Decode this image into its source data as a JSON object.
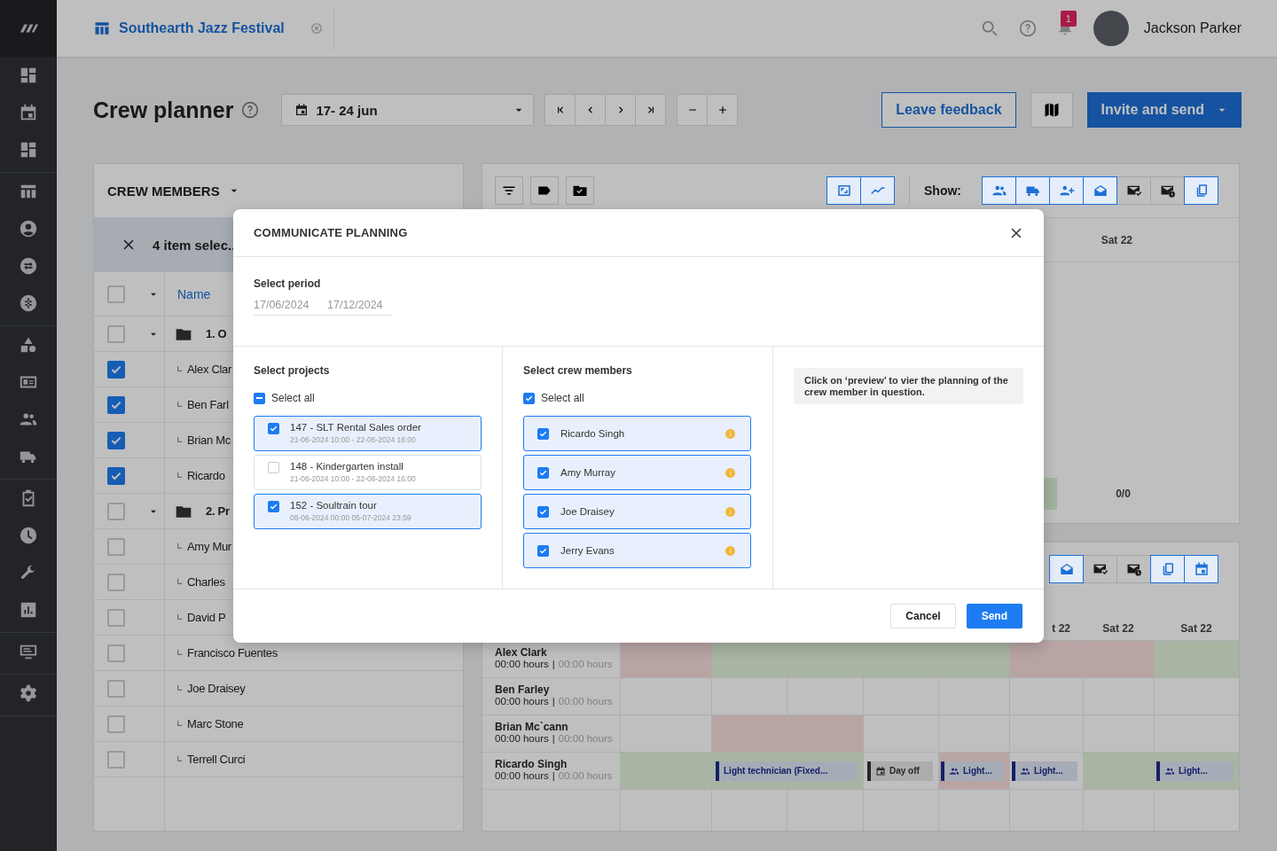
{
  "topbar": {
    "project": "Southearth Jazz Festival",
    "notifications": "1",
    "user": "Jackson Parker"
  },
  "header": {
    "title": "Crew planner",
    "date_range": "17- 24 jun",
    "feedback": "Leave feedback",
    "invite": "Invite and send"
  },
  "crew_panel": {
    "title": "CREW MEMBERS",
    "selection": "4 item selec..",
    "column": {
      "label": "Name",
      "checked": false
    },
    "rows": [
      {
        "kind": "group",
        "label": "1. O",
        "checked": false,
        "expanded": true
      },
      {
        "kind": "member",
        "label": "Alex Clar",
        "checked": true
      },
      {
        "kind": "member",
        "label": "Ben Farl",
        "checked": true
      },
      {
        "kind": "member",
        "label": "Brian Mc",
        "checked": true
      },
      {
        "kind": "member",
        "label": "Ricardo",
        "checked": true
      },
      {
        "kind": "group",
        "label": "2. Pr",
        "checked": false,
        "expanded": true
      },
      {
        "kind": "member",
        "label": "Amy Mur",
        "checked": false
      },
      {
        "kind": "member",
        "label": "Charles",
        "checked": false
      },
      {
        "kind": "member",
        "label": "David P",
        "checked": false
      },
      {
        "kind": "member",
        "label": "Francisco Fuentes",
        "checked": false
      },
      {
        "kind": "member",
        "label": "Joe Draisey",
        "checked": false
      },
      {
        "kind": "member",
        "label": "Marc Stone",
        "checked": false
      },
      {
        "kind": "member",
        "label": "Terrell Curci",
        "checked": false
      }
    ]
  },
  "planner": {
    "view_toggles": [
      {
        "kind": "fit",
        "selected": true
      },
      {
        "kind": "trend",
        "selected": true
      }
    ],
    "show_label": "Show:",
    "show_toggles": [
      {
        "kind": "people",
        "selected": true
      },
      {
        "kind": "truck",
        "selected": true
      },
      {
        "kind": "person-add",
        "selected": true
      },
      {
        "kind": "mail-open",
        "selected": true
      },
      {
        "kind": "mail-check",
        "selected": false
      },
      {
        "kind": "mail-clock",
        "selected": false
      },
      {
        "kind": "copy",
        "selected": true
      }
    ],
    "day_header": "Sat 22",
    "summary": "0/0"
  },
  "schedule": {
    "toggles": [
      {
        "kind": "mail-open",
        "selected": true
      },
      {
        "kind": "mail-check",
        "selected": false
      },
      {
        "kind": "mail-clock",
        "selected": false
      },
      {
        "kind": "copy",
        "selected": true
      },
      {
        "kind": "calendar",
        "selected": true
      }
    ],
    "day_headers": [
      "t 22",
      "Sat 22",
      "Sat 22"
    ],
    "rows": [
      {
        "name": "Alex Clark",
        "hours": "00:00 hours",
        "separator": "|",
        "planned": "00:00 hours",
        "cells": [
          {
            "color": "#b9a4a4"
          },
          {
            "color": "#a8b5a3"
          },
          {
            "color": "#a8b5a3"
          },
          {
            "color": "#a8b5a3"
          },
          {
            "color": "#a8b5a3"
          },
          {
            "color": "#b9a4a4"
          },
          {
            "color": "#b9a4a4"
          },
          {
            "color": "#a8b5a3"
          }
        ]
      },
      {
        "name": "Ben Farley",
        "hours": "00:00 hours",
        "separator": "|",
        "planned": "00:00 hours",
        "cells": [
          {
            "color": "#bfbfbf"
          },
          {
            "color": "#bfbfbf"
          },
          {
            "color": "#bfbfbf"
          },
          {
            "color": "#bfbfbf"
          },
          {
            "color": "#bfbfbf"
          },
          {
            "color": "#bfbfbf"
          },
          {
            "color": "#bfbfbf"
          },
          {
            "color": "#bfbfbf"
          }
        ]
      },
      {
        "name": "Brian Mc`cann",
        "hours": "00:00 hours",
        "separator": "|",
        "planned": "00:00 hours",
        "cells": [
          {
            "color": "#bfbfbf"
          },
          {
            "color": "#b9a4a4"
          },
          {
            "color": "#b9a4a4"
          },
          {
            "color": "#bfbfbf"
          },
          {
            "color": "#bfbfbf"
          },
          {
            "color": "#bfbfbf"
          },
          {
            "color": "#bfbfbf"
          },
          {
            "color": "#bfbfbf"
          }
        ]
      },
      {
        "name": "Ricardo Singh",
        "hours": "00:00 hours",
        "separator": "|",
        "planned": "00:00 hours",
        "cells": [
          {
            "color": "#a8b5a3"
          },
          {
            "color": "#a8b5a3",
            "event": {
              "kind": "shift",
              "label": "Light technician (Fixed...",
              "wide": true
            }
          },
          {
            "color": "#a8b5a3"
          },
          {
            "color": "#bfbfbf",
            "event": {
              "kind": "dayoff",
              "label": "Day off"
            }
          },
          {
            "color": "#b9a4a4",
            "event": {
              "kind": "crew",
              "label": "Light..."
            }
          },
          {
            "color": "#bfbfbf",
            "event": {
              "kind": "crew",
              "label": "Light..."
            }
          },
          {
            "color": "#a8b5a3"
          },
          {
            "color": "#a8b5a3",
            "event": {
              "kind": "crew",
              "label": "Light..."
            }
          }
        ]
      }
    ]
  },
  "modal": {
    "title": "COMMUNICATE PLANNING",
    "period_label": "Select period",
    "period": [
      "17/06/2024",
      "17/12/2024"
    ],
    "projects": {
      "label": "Select projects",
      "select_all": {
        "label": "Select all",
        "indeterminate": true
      },
      "items": [
        {
          "title": "147 - SLT Rental Sales order",
          "dates": "21-06-2024 10:00 - 22-06-2024 16:00",
          "checked": true
        },
        {
          "title": "148 - Kindergarten install",
          "dates": "21-06-2024 10:00 - 22-06-2024 16:00",
          "checked": false
        },
        {
          "title": "152 - Soultrain tour",
          "dates": "08-06-2024 00:00 05-07-2024 23:59",
          "checked": true
        }
      ]
    },
    "crew": {
      "label": "Select crew members",
      "select_all": {
        "label": "Select all",
        "checked": true
      },
      "items": [
        {
          "name": "Ricardo Singh",
          "checked": true
        },
        {
          "name": "Amy Murray",
          "checked": true
        },
        {
          "name": "Joe Draisey",
          "checked": true
        },
        {
          "name": "Jerry Evans",
          "checked": true
        }
      ]
    },
    "note": "Click on ‘preview’ to vier the planning of the crew member in question.",
    "cancel": "Cancel",
    "send": "Send"
  }
}
